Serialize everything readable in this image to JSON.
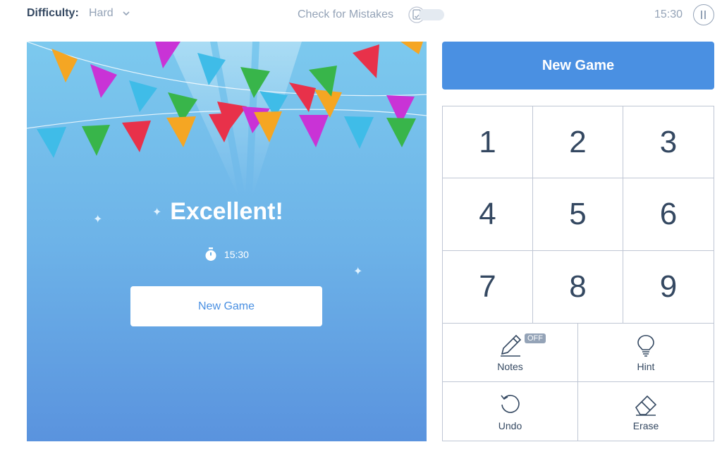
{
  "header": {
    "difficulty_label": "Difficulty:",
    "difficulty_value": "Hard",
    "check_mistakes_label": "Check for Mistakes",
    "check_mistakes_enabled": false,
    "timer": "15:30"
  },
  "board_overlay": {
    "title": "Excellent!",
    "time": "15:30",
    "button_label": "New Game"
  },
  "controls": {
    "new_game_label": "New Game",
    "numbers": [
      "1",
      "2",
      "3",
      "4",
      "5",
      "6",
      "7",
      "8",
      "9"
    ],
    "tools": [
      {
        "label": "Notes",
        "icon": "pencil-icon",
        "badge": "OFF"
      },
      {
        "label": "Hint",
        "icon": "lightbulb-icon"
      },
      {
        "label": "Undo",
        "icon": "undo-icon"
      },
      {
        "label": "Erase",
        "icon": "eraser-icon"
      }
    ]
  },
  "colors": {
    "accent": "#4a90e2",
    "text_dark": "#344861",
    "text_muted": "#94a3b7",
    "grid_border": "#bfc6d4"
  }
}
